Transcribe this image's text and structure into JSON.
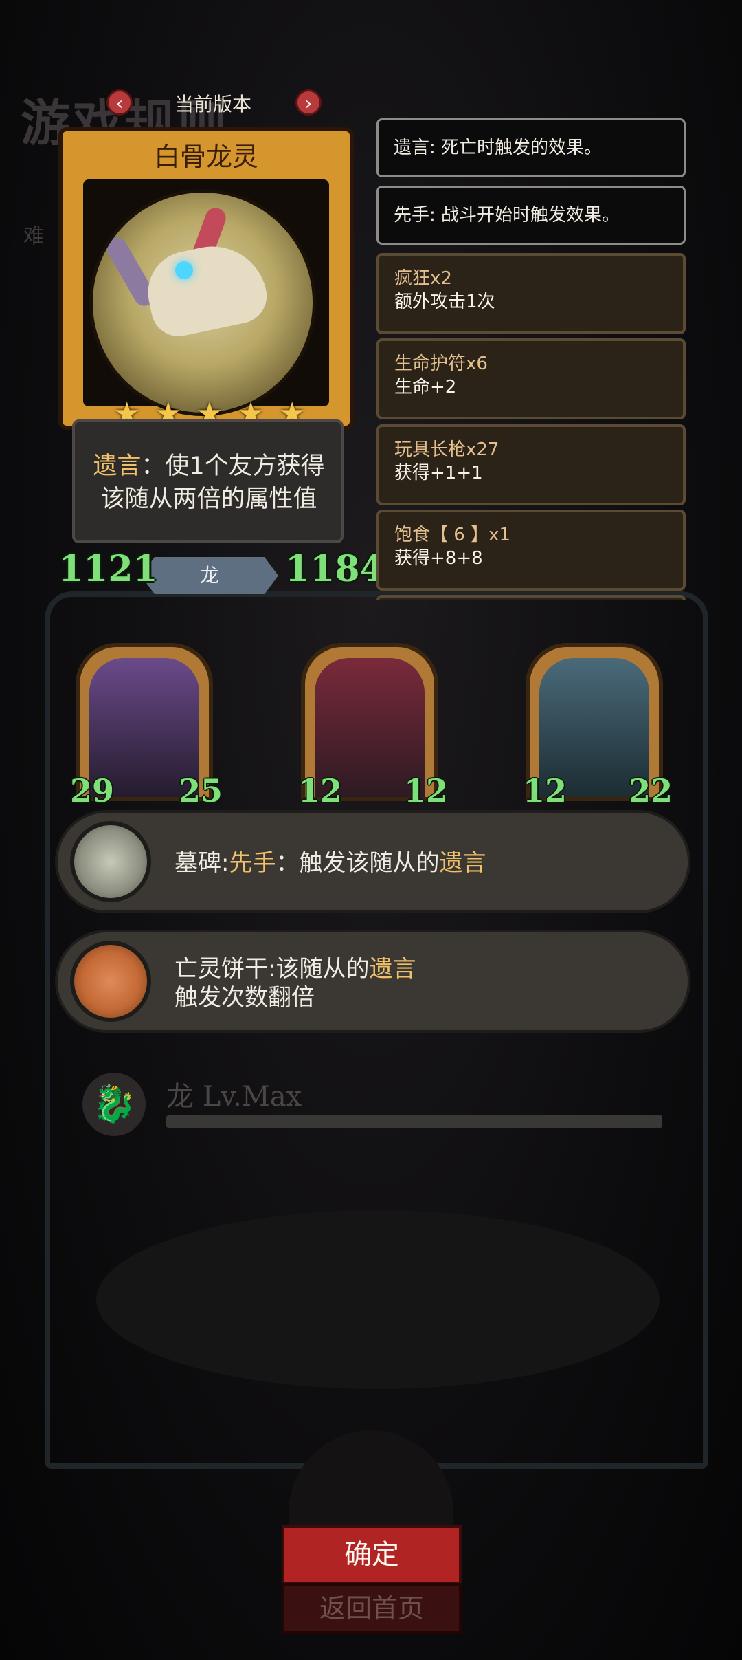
{
  "background": {
    "title": "游戏规则",
    "difficulty": "难"
  },
  "version_bar": {
    "label": "当前版本",
    "prev_icon": "chevron-left-icon",
    "next_icon": "chevron-right-icon"
  },
  "card": {
    "name": "白骨龙灵",
    "stars": 5,
    "desc_keyword": "遗言",
    "desc_sep": "：",
    "desc_line1_rest": "使1个友方获得",
    "desc_line2": "该随从两倍的属性值",
    "race": "龙",
    "attack": "1121",
    "health": "1184"
  },
  "keywords": [
    {
      "text": "遗言: 死亡时触发的效果。"
    },
    {
      "text": "先手: 战斗开始时触发效果。"
    }
  ],
  "buffs": [
    {
      "name": "疯狂x2",
      "effect": "额外攻击1次"
    },
    {
      "name": "生命护符x6",
      "effect": "生命+2"
    },
    {
      "name": "玩具长枪x27",
      "effect": "获得+1+1"
    },
    {
      "name": "饱食【 6 】x1",
      "effect": "获得+8+8"
    }
  ],
  "team": [
    {
      "attack": "29",
      "health": "25"
    },
    {
      "attack": "12",
      "health": "12"
    },
    {
      "attack": "12",
      "health": "22"
    }
  ],
  "enchants": [
    {
      "icon": "tombstone-icon",
      "name": "墓碑:",
      "kw1": "先手",
      "mid": "：触发该随从的",
      "kw2": "遗言"
    },
    {
      "icon": "skull-cookie-icon",
      "name": "亡灵饼干:",
      "line1": "该随从的",
      "kw": "遗言",
      "line2": "触发次数翻倍"
    }
  ],
  "race_level": {
    "icon": "dragon-icon",
    "label": "龙 Lv.Max"
  },
  "buttons": {
    "confirm": "确定",
    "home": "返回首页"
  },
  "colors": {
    "card_gold": "#d6962e",
    "keyword_gold": "#f1c06a",
    "stat_green": "#7fe07a",
    "confirm_red": "#b12424"
  }
}
